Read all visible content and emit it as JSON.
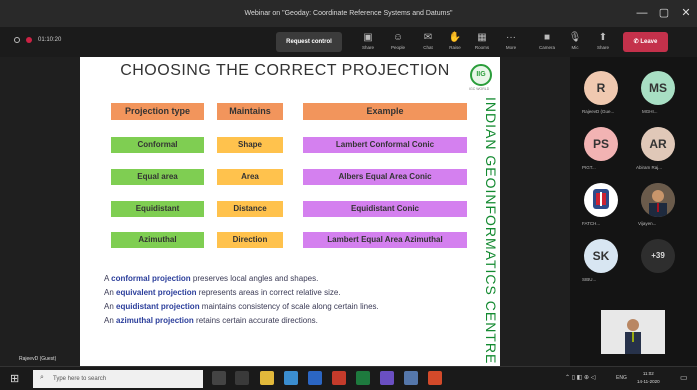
{
  "window": {
    "title": "Webinar on \"Geoday: Coordinate Reference Systems and Datums\"",
    "minimize": "—",
    "restore": "▢",
    "close": "✕"
  },
  "toolbar": {
    "timer": "01:10:20",
    "request_control": "Request control",
    "tools": [
      {
        "icon": "▣",
        "label": "Share"
      },
      {
        "icon": "☺",
        "label": "People"
      },
      {
        "icon": "✉",
        "label": "Chat"
      },
      {
        "icon": "✋",
        "label": "Raise"
      },
      {
        "icon": "▦",
        "label": "Rooms"
      },
      {
        "icon": "···",
        "label": "More"
      },
      {
        "icon": "■",
        "label": "Camera"
      },
      {
        "icon": "🎙",
        "label": "Mic"
      },
      {
        "icon": "⬆",
        "label": "Share"
      }
    ],
    "leave_label": "Leave"
  },
  "slide": {
    "title": "CHOOSING THE CORRECT PROJECTION",
    "logo_text": "IIG",
    "logo_caption": "IGC WORLD",
    "vertical_text": "INDIAN GEOINFORMATICS CENTRE",
    "headers": [
      "Projection type",
      "Maintains",
      "Example"
    ],
    "rows": [
      {
        "type": "Conformal",
        "maintains": "Shape",
        "example": "Lambert Conformal Conic"
      },
      {
        "type": "Equal area",
        "maintains": "Area",
        "example": "Albers Equal Area Conic"
      },
      {
        "type": "Equidistant",
        "maintains": "Distance",
        "example": "Equidistant Conic"
      },
      {
        "type": "Azimuthal",
        "maintains": "Direction",
        "example": "Lambert Equal Area Azimuthal"
      }
    ],
    "descriptions": [
      {
        "pre": "A ",
        "bold": "conformal projection",
        "post": " preserves local angles and shapes."
      },
      {
        "pre": "An ",
        "bold": "equivalent projection",
        "post": " represents areas in correct relative size."
      },
      {
        "pre": "An ",
        "bold": "equidistant projection",
        "post": " maintains consistency of scale along certain lines."
      },
      {
        "pre": "An ",
        "bold": "azimuthal projection",
        "post": " retains certain accurate directions."
      }
    ]
  },
  "participants": [
    {
      "initials": "R",
      "name": "RajeevD (Gue...",
      "color": "#f0c9b0"
    },
    {
      "initials": "MS",
      "name": "MGHI...",
      "color": "#a8dfc4"
    },
    {
      "initials": "PS",
      "name": "PIGT...",
      "color": "#f2b3b3"
    },
    {
      "initials": "AR",
      "name": "Abiram Raj...",
      "color": "#e0c8b8"
    },
    {
      "initials": "",
      "name": "FATCH...",
      "color": "#ffffff"
    },
    {
      "initials": "",
      "name": "Vijayen...",
      "color": "#5a5a5a"
    },
    {
      "initials": "SK",
      "name": "SIBU...",
      "color": "#d8e6f2"
    },
    {
      "initials": "+39",
      "name": "",
      "color": "#2e2e2e"
    }
  ],
  "presenter_name": "RajeevD (Guest)",
  "taskbar": {
    "search_placeholder": "Type here to search",
    "time": "11:02",
    "date": "14-11-2020",
    "lang": "ENG"
  },
  "colors": {
    "header": "#f2955c",
    "type": "#7fce52",
    "maintains": "#ffc24d",
    "example": "#d480ef",
    "leave": "#c4314b"
  }
}
